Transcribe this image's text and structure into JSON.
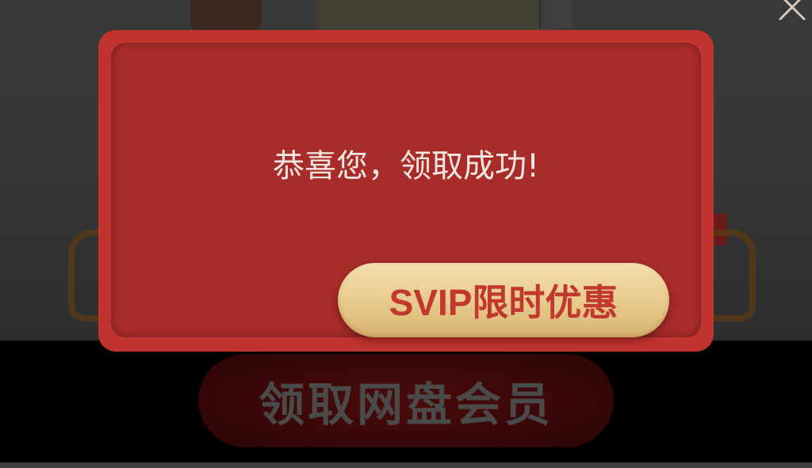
{
  "dialog": {
    "message": "恭喜您，领取成功!",
    "button_label": "SVIP限时优惠"
  },
  "background": {
    "cta_label": "领取网盘会员"
  },
  "icons": {
    "close": "close-icon"
  },
  "colors": {
    "modal_red": "#c0332f",
    "modal_inner_red": "#a82c2a",
    "button_gold": "#e8c98c",
    "button_text": "#c0382e",
    "message_text": "#f4e6e0"
  }
}
